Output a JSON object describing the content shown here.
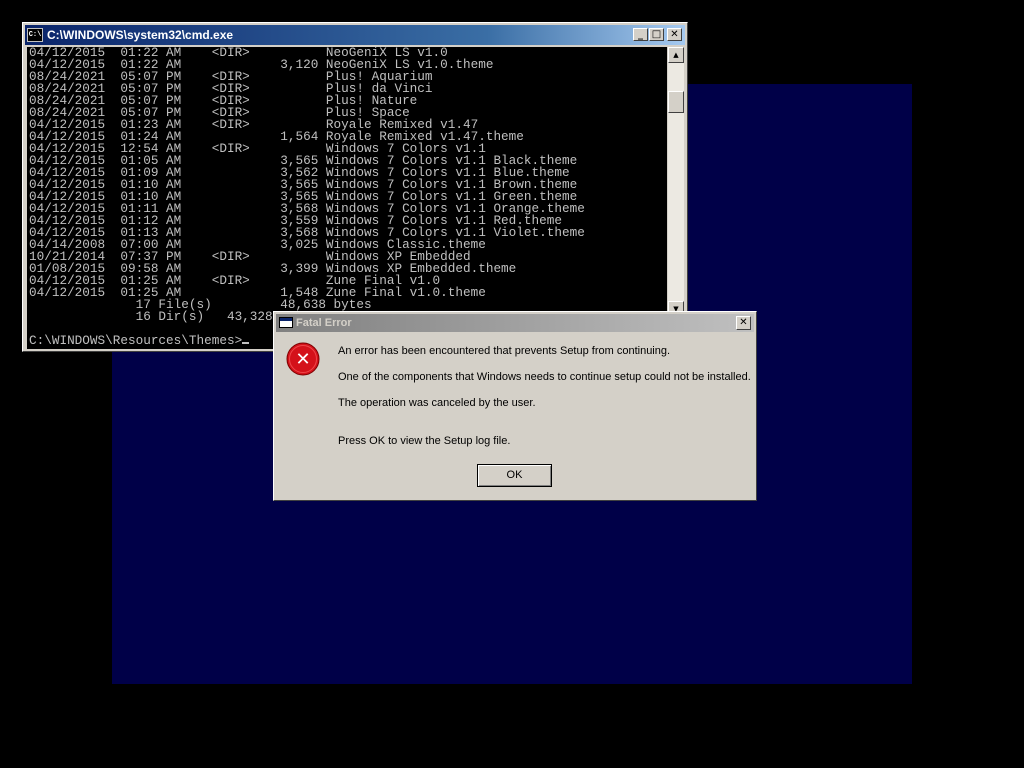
{
  "colors": {
    "desktop_background": "#000048",
    "screen_background": "#000000",
    "console_background": "#000000",
    "console_text": "#c0c0c0",
    "dialog_face": "#d4d0c8",
    "active_titlebar": "#0a246a",
    "inactive_titlebar": "#808080",
    "error_icon_red": "#d4111a"
  },
  "console": {
    "app_icon_label": "C:\\",
    "title": "C:\\WINDOWS\\system32\\cmd.exe",
    "minimize_glyph": "_",
    "maximize_glyph": "□",
    "close_glyph": "✕",
    "scroll_up_glyph": "▲",
    "scroll_down_glyph": "▼",
    "output_lines": [
      "04/12/2015  01:22 AM    <DIR>          NeoGeniX LS v1.0",
      "04/12/2015  01:22 AM             3,120 NeoGeniX LS v1.0.theme",
      "08/24/2021  05:07 PM    <DIR>          Plus! Aquarium",
      "08/24/2021  05:07 PM    <DIR>          Plus! da Vinci",
      "08/24/2021  05:07 PM    <DIR>          Plus! Nature",
      "08/24/2021  05:07 PM    <DIR>          Plus! Space",
      "04/12/2015  01:23 AM    <DIR>          Royale Remixed v1.47",
      "04/12/2015  01:24 AM             1,564 Royale Remixed v1.47.theme",
      "04/12/2015  12:54 AM    <DIR>          Windows 7 Colors v1.1",
      "04/12/2015  01:05 AM             3,565 Windows 7 Colors v1.1 Black.theme",
      "04/12/2015  01:09 AM             3,562 Windows 7 Colors v1.1 Blue.theme",
      "04/12/2015  01:10 AM             3,565 Windows 7 Colors v1.1 Brown.theme",
      "04/12/2015  01:10 AM             3,565 Windows 7 Colors v1.1 Green.theme",
      "04/12/2015  01:11 AM             3,568 Windows 7 Colors v1.1 Orange.theme",
      "04/12/2015  01:12 AM             3,559 Windows 7 Colors v1.1 Red.theme",
      "04/12/2015  01:13 AM             3,568 Windows 7 Colors v1.1 Violet.theme",
      "04/14/2008  07:00 AM             3,025 Windows Classic.theme",
      "10/21/2014  07:37 PM    <DIR>          Windows XP Embedded",
      "01/08/2015  09:58 AM             3,399 Windows XP Embedded.theme",
      "04/12/2015  01:25 AM    <DIR>          Zune Final v1.0",
      "04/12/2015  01:25 AM             1,548 Zune Final v1.0.theme",
      "              17 File(s)         48,638 bytes",
      "              16 Dir(s)   43,328"
    ],
    "prompt": "C:\\WINDOWS\\Resources\\Themes>"
  },
  "dialog": {
    "title": "Fatal Error",
    "close_glyph": "✕",
    "error_glyph": "✕",
    "lines": [
      "An error has been encountered that prevents Setup from continuing.",
      "One of the components that Windows needs to continue setup could not be installed.",
      "The operation was canceled by the user.",
      "Press OK to view the Setup log file."
    ],
    "ok_label": "OK"
  }
}
